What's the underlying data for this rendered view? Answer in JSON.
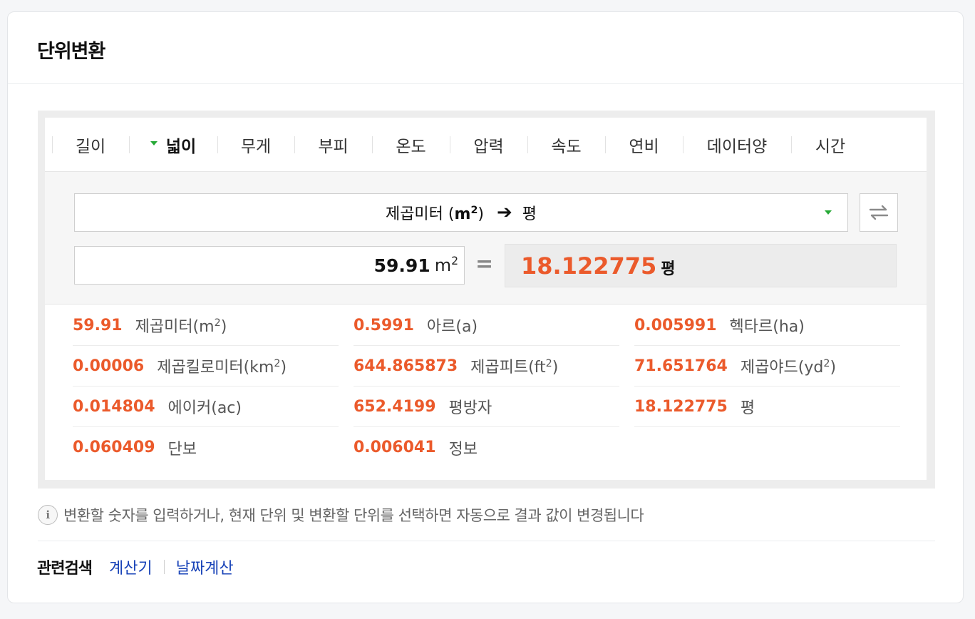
{
  "title": "단위변환",
  "tabs": [
    {
      "label": "길이",
      "active": false
    },
    {
      "label": "넓이",
      "active": true
    },
    {
      "label": "무게",
      "active": false
    },
    {
      "label": "부피",
      "active": false
    },
    {
      "label": "온도",
      "active": false
    },
    {
      "label": "압력",
      "active": false
    },
    {
      "label": "속도",
      "active": false
    },
    {
      "label": "연비",
      "active": false
    },
    {
      "label": "데이터양",
      "active": false
    },
    {
      "label": "시간",
      "active": false
    }
  ],
  "converter": {
    "from_unit_name": "제곱미터",
    "from_unit_symbol": "m",
    "from_unit_exp": "2",
    "arrow": "➔",
    "to_unit": "평",
    "input_value": "59.91",
    "input_unit": "m",
    "input_unit_exp": "2",
    "equals": "=",
    "result_value": "18.122775",
    "result_unit": "평"
  },
  "results": [
    {
      "value": "59.91",
      "name": "제곱미터(m",
      "exp": "2",
      "close": ")"
    },
    {
      "value": "0.5991",
      "name": "아르(a)",
      "exp": "",
      "close": ""
    },
    {
      "value": "0.005991",
      "name": "헥타르(ha)",
      "exp": "",
      "close": ""
    },
    {
      "value": "0.00006",
      "name": "제곱킬로미터(km",
      "exp": "2",
      "close": ")"
    },
    {
      "value": "644.865873",
      "name": "제곱피트(ft",
      "exp": "2",
      "close": ")"
    },
    {
      "value": "71.651764",
      "name": "제곱야드(yd",
      "exp": "2",
      "close": ")"
    },
    {
      "value": "0.014804",
      "name": "에이커(ac)",
      "exp": "",
      "close": ""
    },
    {
      "value": "652.4199",
      "name": "평방자",
      "exp": "",
      "close": ""
    },
    {
      "value": "18.122775",
      "name": "평",
      "exp": "",
      "close": ""
    },
    {
      "value": "0.060409",
      "name": "단보",
      "exp": "",
      "close": ""
    },
    {
      "value": "0.006041",
      "name": "정보",
      "exp": "",
      "close": ""
    }
  ],
  "notice": "변환할 숫자를 입력하거나, 현재 단위 및 변환할 단위를 선택하면 자동으로 결과 값이 변경됩니다",
  "related": {
    "label": "관련검색",
    "links": [
      "계산기",
      "날짜계산"
    ]
  },
  "colors": {
    "accent_orange": "#eb5a2b",
    "green_caret": "#26a936",
    "link_blue": "#1a44b8"
  },
  "icons": {
    "info": "info-icon",
    "swap": "swap-icon",
    "dropdown": "chevron-down-icon"
  }
}
